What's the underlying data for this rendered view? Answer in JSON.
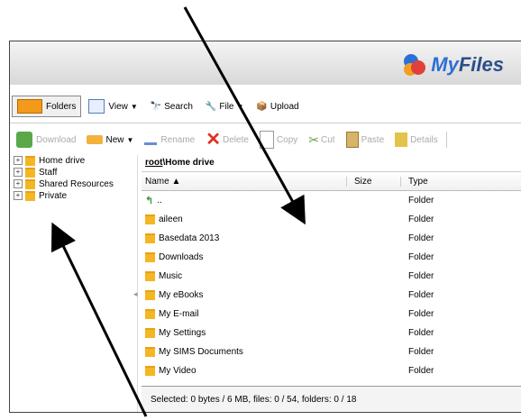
{
  "app": {
    "logo_prefix": "My",
    "logo_suffix": "Files"
  },
  "toolbar1": [
    {
      "label": "Folders",
      "icon": "folders-icon",
      "active": true
    },
    {
      "label": "View",
      "icon": "view-icon",
      "dropdown": true
    },
    {
      "label": "Search",
      "icon": "search-icon"
    },
    {
      "label": "File",
      "icon": "file-icon",
      "dropdown": true
    },
    {
      "label": "Upload",
      "icon": "upload-icon"
    }
  ],
  "toolbar2": {
    "download": "Download",
    "new": "New",
    "rename": "Rename",
    "delete": "Delete",
    "copy": "Copy",
    "cut": "Cut",
    "paste": "Paste",
    "details": "Details"
  },
  "tree": [
    {
      "label": "Home drive"
    },
    {
      "label": "Staff"
    },
    {
      "label": "Shared Resources"
    },
    {
      "label": "Private"
    }
  ],
  "breadcrumb": {
    "root": "root",
    "sep": "\\",
    "current": "Home drive"
  },
  "columns": {
    "name": "Name ▲",
    "size": "Size",
    "type": "Type"
  },
  "rows": [
    {
      "name": "..",
      "type": "Folder",
      "up": true
    },
    {
      "name": "aileen",
      "type": "Folder"
    },
    {
      "name": "Basedata 2013",
      "type": "Folder"
    },
    {
      "name": "Downloads",
      "type": "Folder"
    },
    {
      "name": "Music",
      "type": "Folder"
    },
    {
      "name": "My eBooks",
      "type": "Folder"
    },
    {
      "name": "My E-mail",
      "type": "Folder"
    },
    {
      "name": "My Settings",
      "type": "Folder"
    },
    {
      "name": "My SIMS Documents",
      "type": "Folder"
    },
    {
      "name": "My Video",
      "type": "Folder"
    }
  ],
  "status": "Selected: 0 bytes / 6 MB, files: 0 / 54, folders: 0 / 18",
  "colors": {
    "accent": "#f39a1a",
    "logo_blue": "#2d6fd6",
    "folder": "#f5b623"
  }
}
